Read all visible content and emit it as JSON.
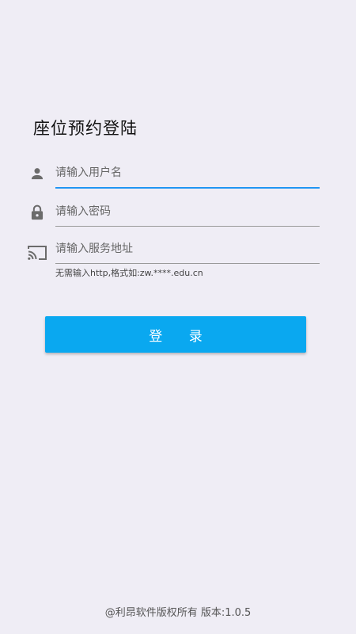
{
  "login": {
    "title": "座位预约登陆",
    "username_placeholder": "请输入用户名",
    "password_placeholder": "请输入密码",
    "server_placeholder": "请输入服务地址",
    "server_hint": "无需输入http,格式如:zw.****.edu.cn",
    "submit_label": "登 录"
  },
  "icons": {
    "username": "person-icon",
    "password": "lock-icon",
    "server": "cast-icon"
  },
  "colors": {
    "background": "#efedf5",
    "accent": "#0aa8f0",
    "focus_underline": "#2196f3",
    "icon": "#6b6b6b"
  },
  "footer": {
    "copyright": "@利昂软件版权所有 版本:1.0.5"
  }
}
